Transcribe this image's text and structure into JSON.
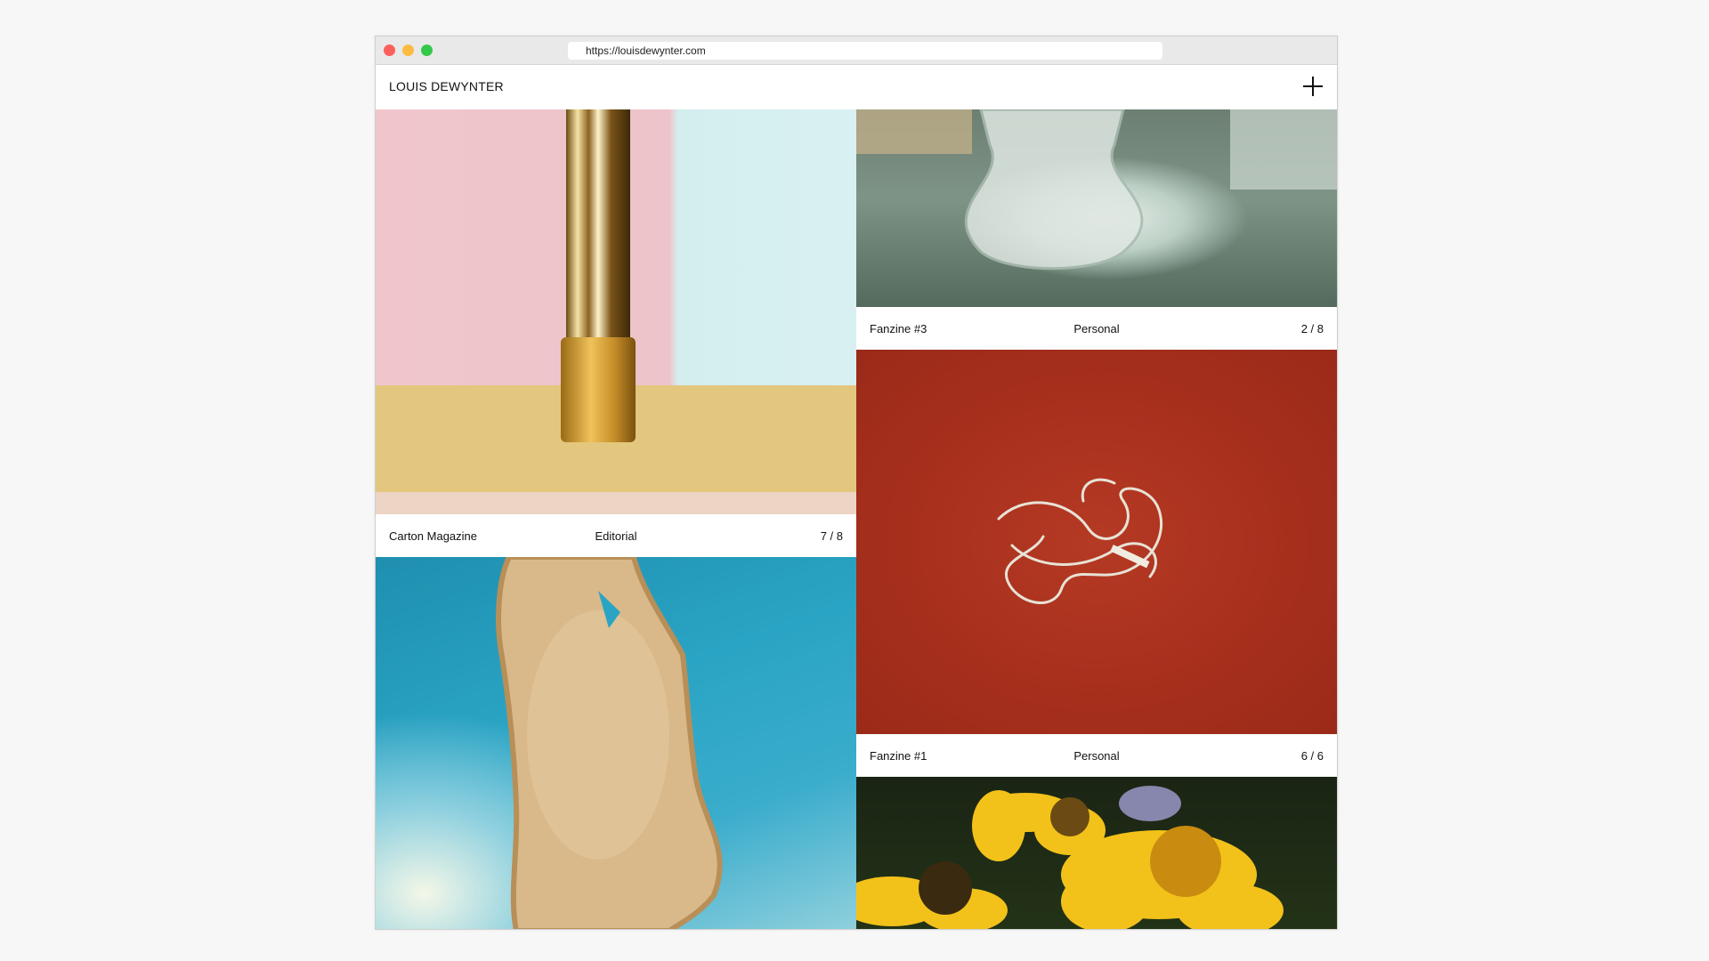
{
  "browser": {
    "url": "https://louisdewynter.com"
  },
  "header": {
    "logo": "LOUIS DEWYNTER",
    "menu_icon": "plus-icon"
  },
  "projects": [
    {
      "title": "Carton Magazine",
      "category": "Editorial",
      "count": "7 / 8",
      "image": "gold lipstick tube on pink and blue background"
    },
    {
      "title": "Fanzine #3",
      "category": "Personal",
      "count": "2 / 8",
      "image": "glass objects on green marble"
    },
    {
      "title": "Fanzine #1",
      "category": "Personal",
      "count": "6 / 6",
      "image": "silver chain on red felt"
    }
  ],
  "colors": {
    "close": "#fc605c",
    "minimize": "#fdbc40",
    "maximize": "#34c84a"
  }
}
